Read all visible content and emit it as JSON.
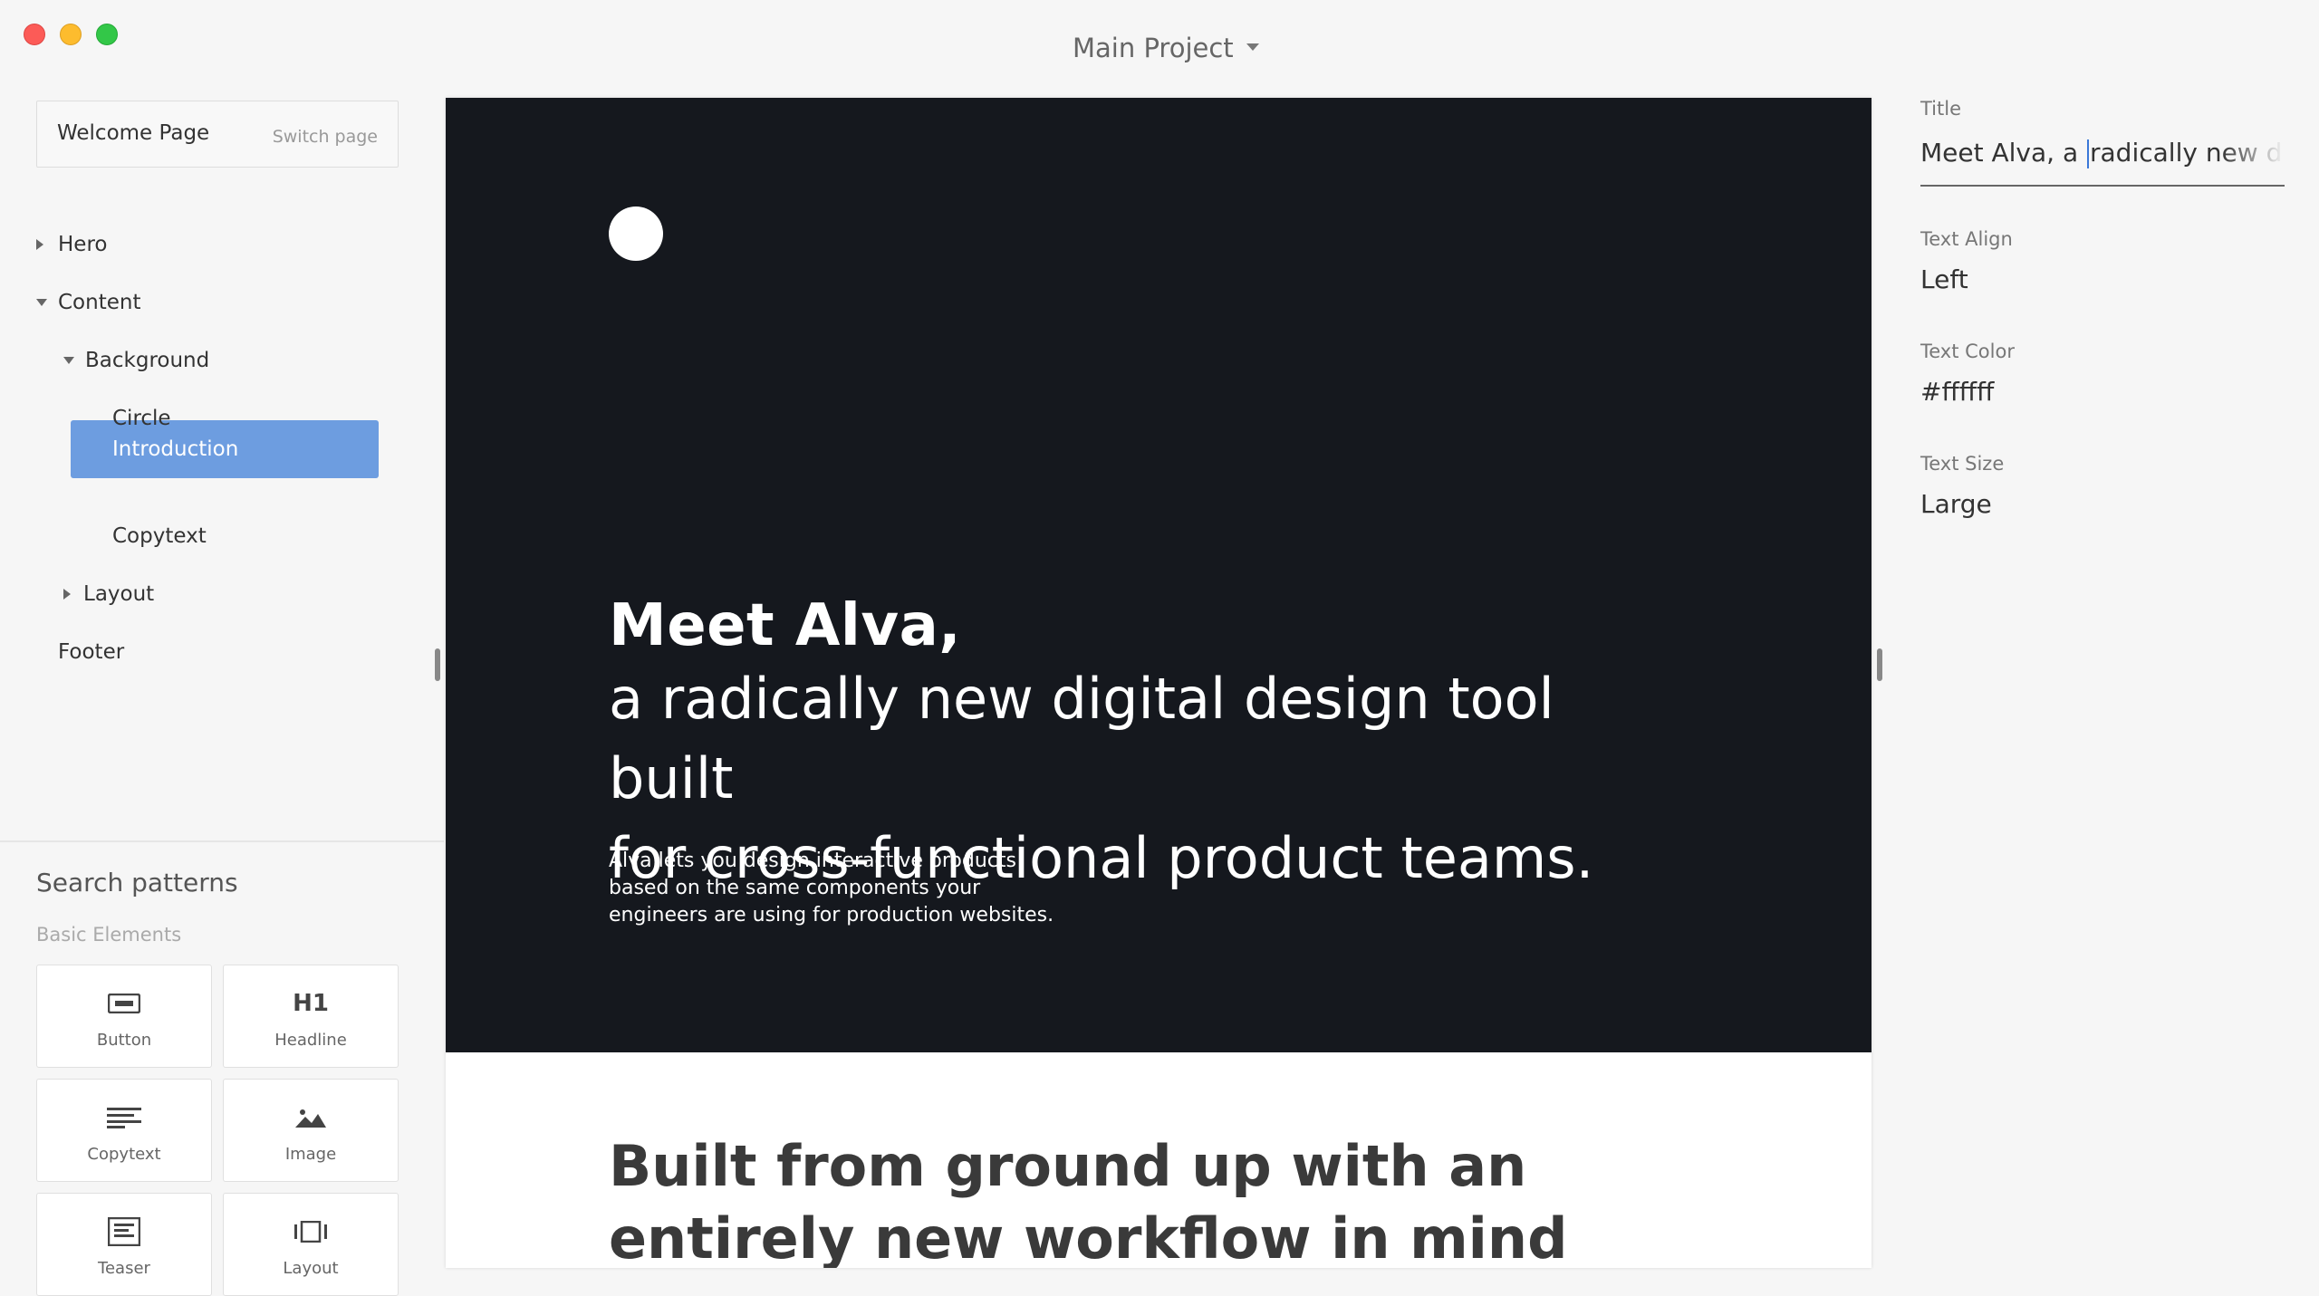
{
  "titlebar": {
    "project_name": "Main Project"
  },
  "sidebar": {
    "page_name": "Welcome Page",
    "switch_label": "Switch page",
    "tree": {
      "hero": "Hero",
      "content": "Content",
      "background": "Background",
      "circle": "Circle",
      "introduction": "Introduction",
      "copytext": "Copytext",
      "layout": "Layout",
      "footer": "Footer"
    },
    "selected_item": "Introduction",
    "selected_color": "#6d9de0",
    "search_title": "Search patterns",
    "category_label": "Basic Elements",
    "patterns": {
      "button": "Button",
      "headline": "Headline",
      "headline_icon_text": "H1",
      "copytext": "Copytext",
      "image": "Image",
      "teaser": "Teaser",
      "layout": "Layout"
    }
  },
  "preview": {
    "hero_background": "#15181e",
    "hero_headline": "Meet Alva,",
    "hero_sub_line1": "a radically new digital design tool built",
    "hero_sub_line2": "for cross-functional product teams.",
    "hero_copy_line1": "Alva lets you design interactive products",
    "hero_copy_line2": "based on the same components your",
    "hero_copy_line3": "engineers are using for production websites.",
    "section_headline_line1": "Built from ground up with an",
    "section_headline_line2": "entirely new workflow in mind"
  },
  "properties": {
    "title_label": "Title",
    "title_value_before_cursor": "Meet Alva, a ",
    "title_value_after_cursor": "radically new dig",
    "text_align_label": "Text Align",
    "text_align_value": "Left",
    "text_color_label": "Text Color",
    "text_color_value": "#ffffff",
    "text_size_label": "Text Size",
    "text_size_value": "Large"
  }
}
